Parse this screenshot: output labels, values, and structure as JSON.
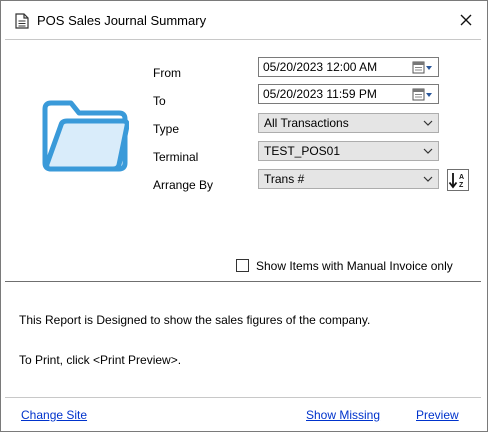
{
  "window": {
    "title": "POS Sales Journal Summary"
  },
  "form": {
    "from_label": "From",
    "from_value": "05/20/2023 12:00 AM",
    "to_label": "To",
    "to_value": "05/20/2023 11:59 PM",
    "type_label": "Type",
    "type_value": "All Transactions",
    "terminal_label": "Terminal",
    "terminal_value": "TEST_POS01",
    "arrange_label": "Arrange By",
    "arrange_value": "Trans #",
    "manual_invoice_label": "Show Items with Manual Invoice only",
    "manual_invoice_checked": false
  },
  "description": {
    "line1": "This Report is Designed to show the sales figures of the company.",
    "line2": "To Print, click <Print Preview>."
  },
  "footer": {
    "change_site": "Change Site",
    "show_missing": "Show Missing",
    "preview": "Preview"
  },
  "icons": {
    "title": "report-document-icon",
    "close": "close-icon",
    "folder": "folder-icon",
    "calendar": "calendar-dropdown-icon",
    "dropdown": "chevron-down-icon",
    "sort": "sort-az-icon"
  },
  "colors": {
    "folder_blue": "#3a9ad9",
    "link_blue": "#0033cc"
  }
}
